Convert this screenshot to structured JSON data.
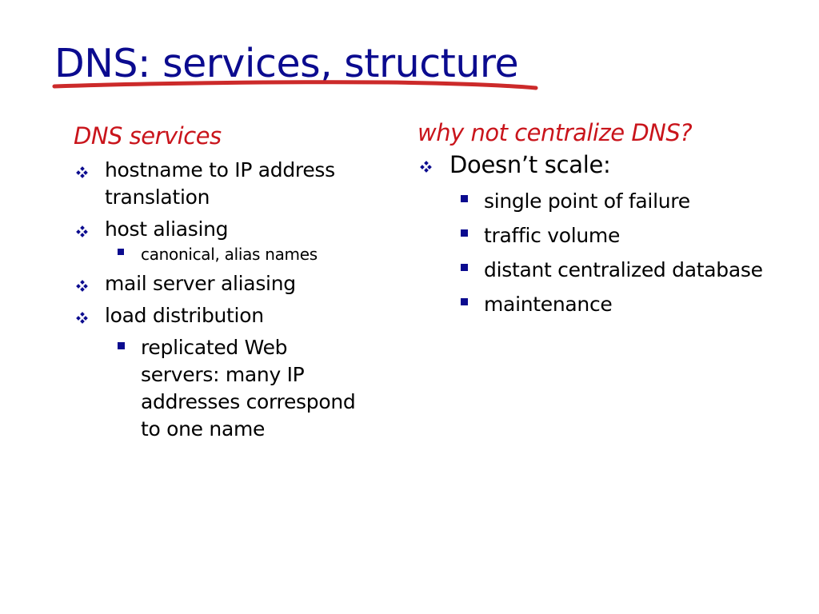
{
  "slide": {
    "title": "DNS: services, structure",
    "colors": {
      "title": "#0b0b8f",
      "heading": "#c9141b",
      "underline": "#cc2a2a",
      "bullet": "#0b0b8f"
    },
    "left": {
      "heading": "DNS services",
      "items": [
        {
          "text": "hostname to IP address translation"
        },
        {
          "text": "host aliasing",
          "sub": [
            "canonical, alias names"
          ]
        },
        {
          "text": "mail server aliasing"
        },
        {
          "text": "load distribution",
          "sub": [
            "replicated Web servers: many IP addresses correspond to one name"
          ]
        }
      ]
    },
    "right": {
      "heading": "why not centralize DNS?",
      "items": [
        {
          "text": "Doesn’t scale:",
          "sub": [
            "single point of failure",
            "traffic volume",
            "distant centralized database",
            "maintenance"
          ]
        }
      ]
    }
  }
}
